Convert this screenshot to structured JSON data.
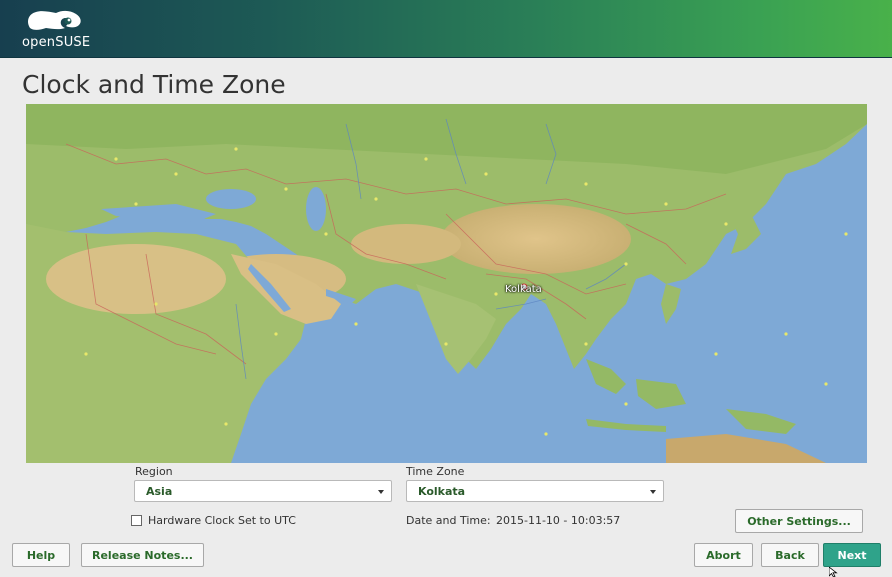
{
  "header": {
    "logo_text": "openSUSE"
  },
  "page": {
    "title": "Clock and Time Zone"
  },
  "map": {
    "selected_city": "Kolkata"
  },
  "region": {
    "label": "Region",
    "value": "Asia"
  },
  "timezone": {
    "label": "Time Zone",
    "value": "Kolkata"
  },
  "hardware_clock": {
    "label": "Hardware Clock Set to UTC",
    "checked": false
  },
  "datetime": {
    "label": "Date and Time:",
    "value": "2015-11-10 - 10:03:57"
  },
  "buttons": {
    "other_settings": "Other Settings...",
    "help": "Help",
    "release_notes": "Release Notes...",
    "abort": "Abort",
    "back": "Back",
    "next": "Next"
  },
  "colors": {
    "header_start": "#173f4f",
    "header_end": "#49b14a",
    "accent": "#2fa38a",
    "ocean": "#7ea9d6",
    "land": "#9cbc6a",
    "desert": "#d9bd80"
  }
}
